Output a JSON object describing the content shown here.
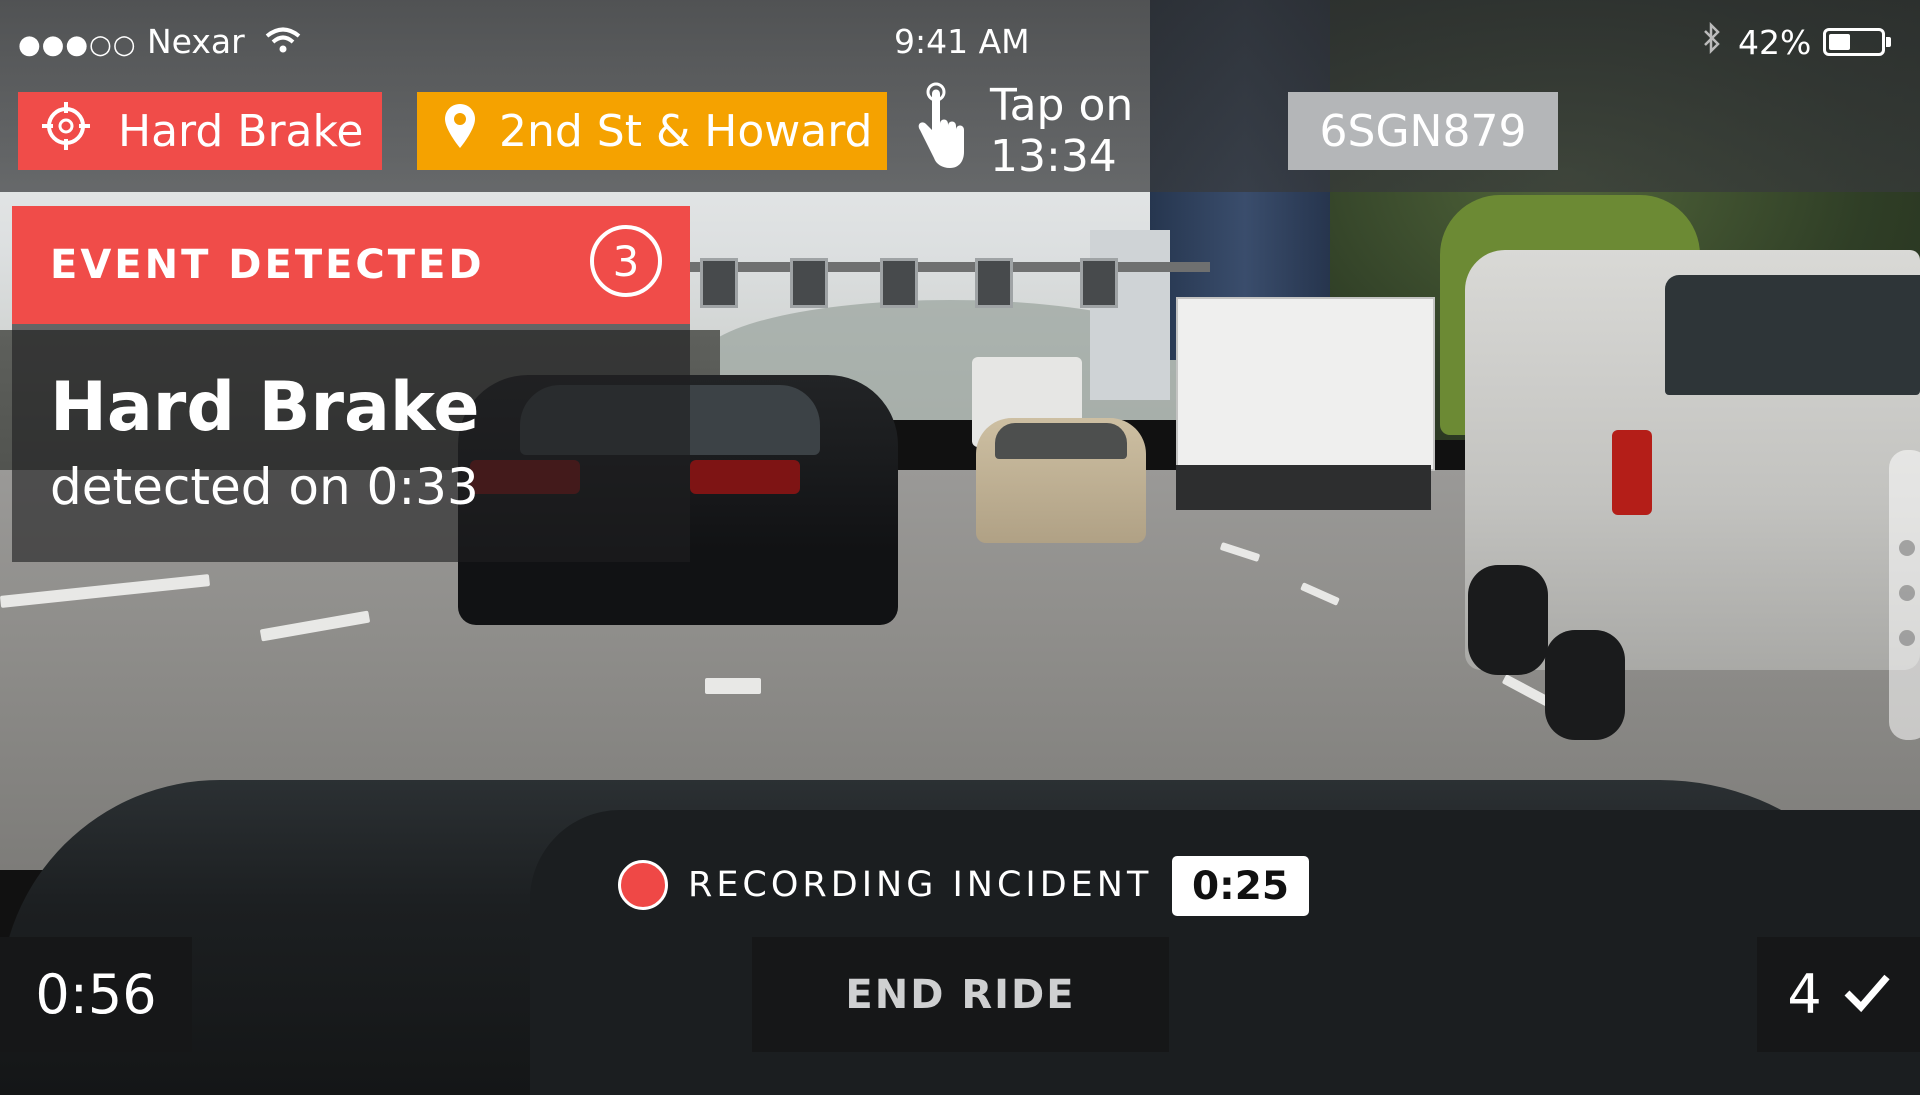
{
  "status_bar": {
    "carrier": "Nexar",
    "signal_dots": "●●●○○",
    "time": "9:41 AM",
    "battery_percent": "42%",
    "battery_level": 0.42
  },
  "top_bar": {
    "event_chip": {
      "label": "Hard Brake",
      "color": "#f04c49"
    },
    "location_chip": {
      "label": "2nd St & Howard",
      "color": "#f5a200"
    },
    "tap_hint": "Tap on 13:34",
    "plate": "6SGN879"
  },
  "event_panel": {
    "header": "EVENT DETECTED",
    "count": "3",
    "title": "Hard Brake",
    "subtitle": "detected on 0:33"
  },
  "recording": {
    "label": "RECORDING INCIDENT",
    "timer": "0:25"
  },
  "bottom_bar": {
    "ride_time": "0:56",
    "end_ride_label": "END RIDE",
    "events_count": "4"
  }
}
